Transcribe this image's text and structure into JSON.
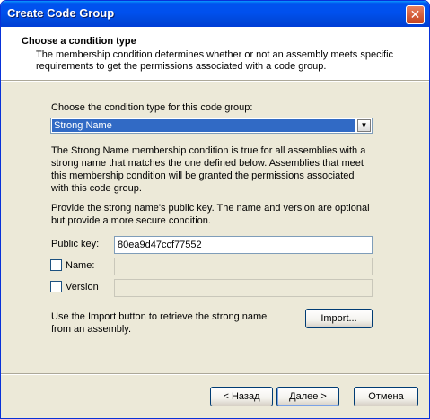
{
  "window": {
    "title": "Create Code Group",
    "close_icon": "close-icon"
  },
  "header": {
    "title": "Choose a condition type",
    "description": "The membership condition determines whether or not an assembly meets specific requirements to get the permissions associated with a code group."
  },
  "condition": {
    "prompt": "Choose the condition type for this code group:",
    "selected": "Strong Name"
  },
  "paragraph1": "The Strong Name membership condition is true for all assemblies with a strong name that matches the one defined below.  Assemblies that meet this membership condition will be granted the permissions associated with this code group.",
  "paragraph2": "Provide the strong name's public key.  The name and version are optional but provide a more secure condition.",
  "fields": {
    "public_key_label": "Public key:",
    "public_key_value": "80ea9d47ccf77552",
    "name_label": "Name:",
    "name_checked": false,
    "version_label": "Version",
    "version_checked": false
  },
  "import": {
    "text": "Use the Import button to retrieve the strong name from an assembly.",
    "button_label": "Import..."
  },
  "footer": {
    "back_label": "< Назад",
    "next_label": "Далее >",
    "cancel_label": "Отмена"
  },
  "colors": {
    "titlebar": "#0053ee",
    "dialog_bg": "#ece9d8",
    "selection": "#316ac5"
  }
}
